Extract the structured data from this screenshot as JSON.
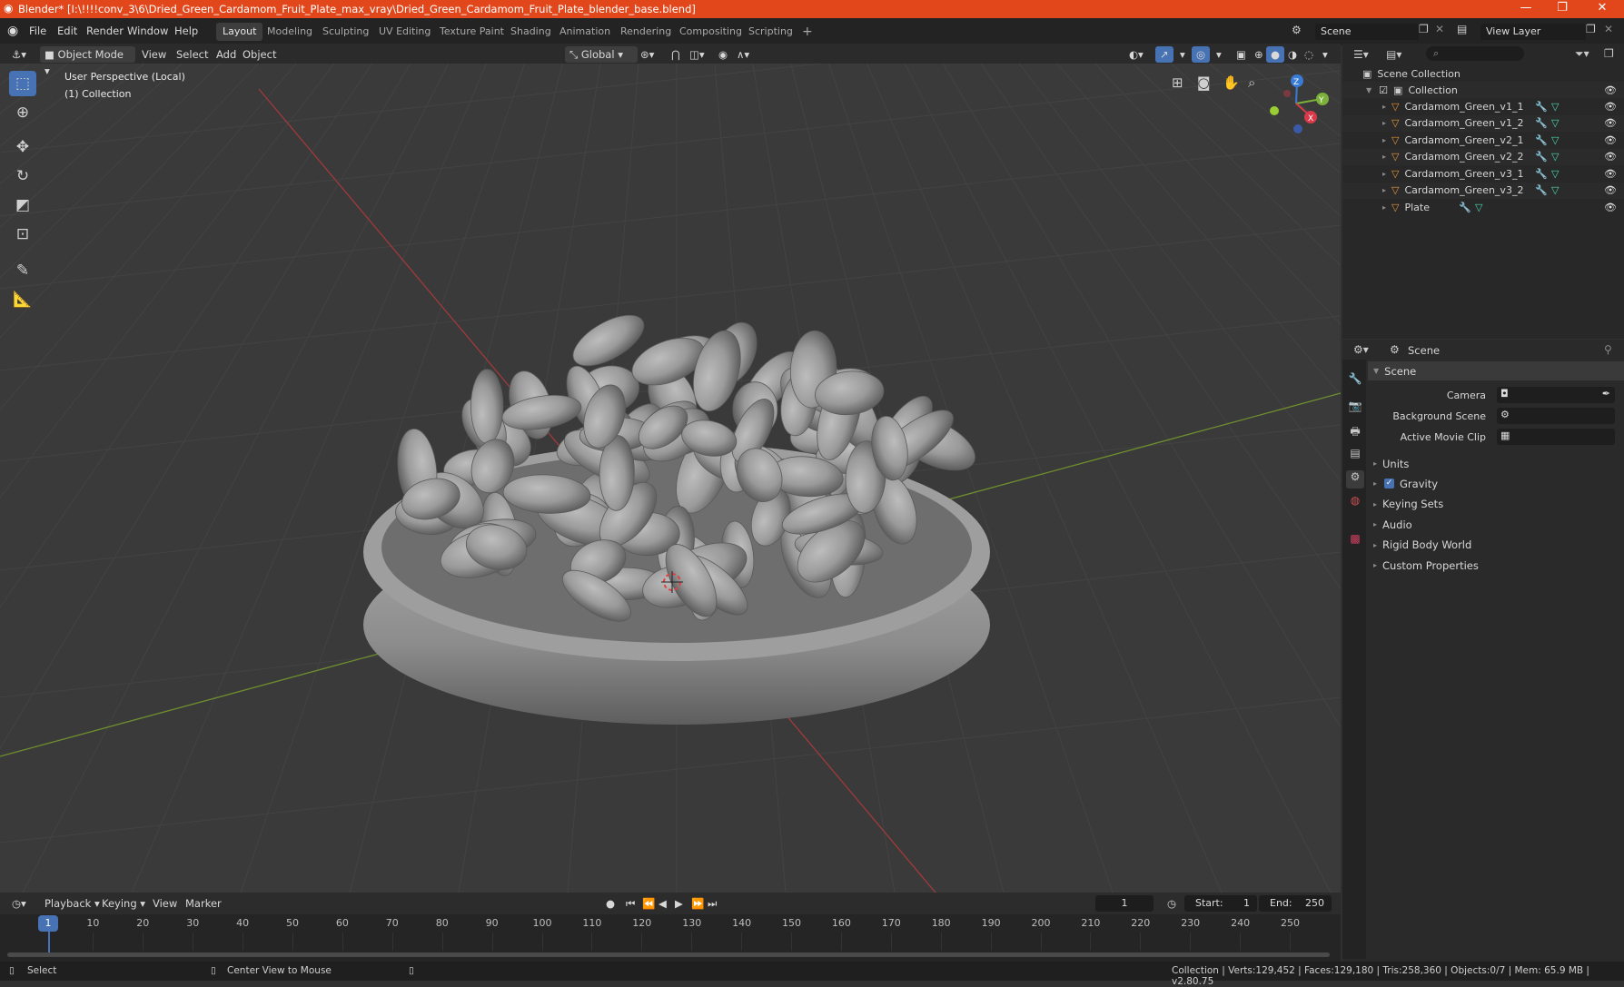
{
  "window": {
    "title": "Blender* [I:\\!!!!conv_3\\6\\Dried_Green_Cardamom_Fruit_Plate_max_vray\\Dried_Green_Cardamom_Fruit_Plate_blender_base.blend]",
    "minimize": "—",
    "maximize": "❐",
    "close": "✕"
  },
  "menu": [
    "File",
    "Edit",
    "Render",
    "Window",
    "Help"
  ],
  "workspaces": [
    "Layout",
    "Modeling",
    "Sculpting",
    "UV Editing",
    "Texture Paint",
    "Shading",
    "Animation",
    "Rendering",
    "Compositing",
    "Scripting"
  ],
  "add_workspace": "+",
  "scene_field": "Scene",
  "view_layer_field": "View Layer",
  "viewport_header": {
    "mode": "Object Mode",
    "menus": [
      "View",
      "Select",
      "Add",
      "Object"
    ],
    "orientation": "Global"
  },
  "viewport": {
    "perspective": "User Perspective (Local)",
    "collection": "(1) Collection",
    "gizmo": {
      "z": "Z",
      "y": "Y",
      "x": "X"
    }
  },
  "outliner": {
    "root": "Scene Collection",
    "collection": "Collection",
    "objects": [
      "Cardamom_Green_v1_1",
      "Cardamom_Green_v1_2",
      "Cardamom_Green_v2_1",
      "Cardamom_Green_v2_2",
      "Cardamom_Green_v3_1",
      "Cardamom_Green_v3_2",
      "Plate"
    ]
  },
  "properties": {
    "header": "Scene",
    "panel": "Scene",
    "fields": {
      "camera": "Camera",
      "background_scene": "Background Scene",
      "active_movie_clip": "Active Movie Clip"
    },
    "panels": [
      "Units",
      "Gravity",
      "Keying Sets",
      "Audio",
      "Rigid Body World",
      "Custom Properties"
    ],
    "gravity_checked": true
  },
  "timeline": {
    "menus": [
      "Playback",
      "Keying",
      "View",
      "Marker"
    ],
    "current_frame": "1",
    "start_label": "Start:",
    "start": "1",
    "end_label": "End:",
    "end": "250",
    "ticks": [
      "1",
      "10",
      "20",
      "30",
      "40",
      "50",
      "60",
      "70",
      "80",
      "90",
      "100",
      "110",
      "120",
      "130",
      "140",
      "150",
      "160",
      "170",
      "180",
      "190",
      "200",
      "210",
      "220",
      "230",
      "240",
      "250"
    ]
  },
  "statusbar": {
    "left": "Select",
    "middle": "Center View to Mouse",
    "right": "Collection | Verts:129,452 | Faces:129,180 | Tris:258,360 | Objects:0/7 | Mem: 65.9 MB | v2.80.75"
  },
  "colors": {
    "accent": "#4772b3",
    "title_bar": "#e2471c",
    "object_icon": "#e8953a",
    "modifier_icon": "#6cb5f5",
    "mesh_icon": "#4bd9b1"
  }
}
